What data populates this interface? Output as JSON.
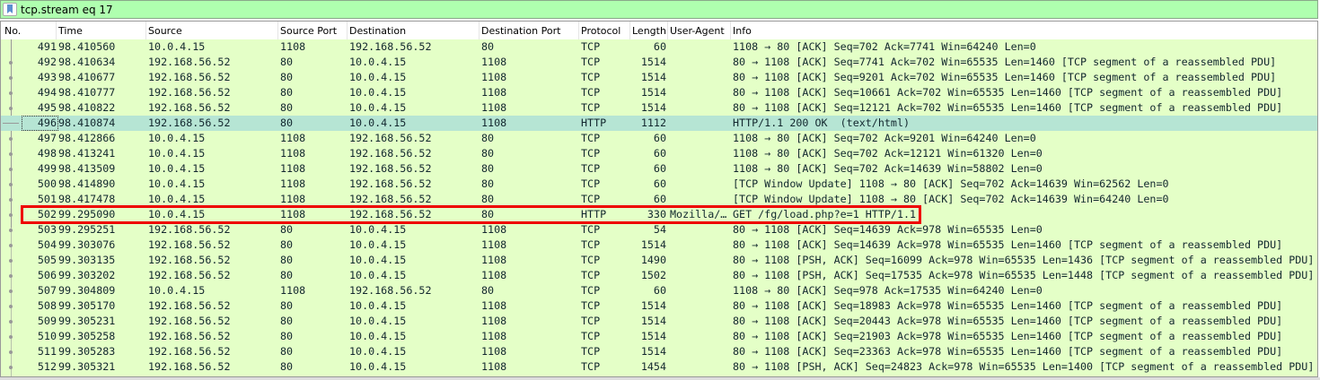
{
  "filter": {
    "value": "tcp.stream eq 17"
  },
  "columns": [
    "No.",
    "Time",
    "Source",
    "Source Port",
    "Destination",
    "Destination Port",
    "Protocol",
    "Length",
    "User-Agent",
    "Info"
  ],
  "selected_no": "496",
  "highlighted_no": "502",
  "rows": [
    [
      "491",
      "98.410560",
      "10.0.4.15",
      "1108",
      "192.168.56.52",
      "80",
      "TCP",
      "60",
      "",
      "1108 → 80 [ACK] Seq=702 Ack=7741 Win=64240 Len=0"
    ],
    [
      "492",
      "98.410634",
      "192.168.56.52",
      "80",
      "10.0.4.15",
      "1108",
      "TCP",
      "1514",
      "",
      "80 → 1108 [ACK] Seq=7741 Ack=702 Win=65535 Len=1460 [TCP segment of a reassembled PDU]"
    ],
    [
      "493",
      "98.410677",
      "192.168.56.52",
      "80",
      "10.0.4.15",
      "1108",
      "TCP",
      "1514",
      "",
      "80 → 1108 [ACK] Seq=9201 Ack=702 Win=65535 Len=1460 [TCP segment of a reassembled PDU]"
    ],
    [
      "494",
      "98.410777",
      "192.168.56.52",
      "80",
      "10.0.4.15",
      "1108",
      "TCP",
      "1514",
      "",
      "80 → 1108 [ACK] Seq=10661 Ack=702 Win=65535 Len=1460 [TCP segment of a reassembled PDU]"
    ],
    [
      "495",
      "98.410822",
      "192.168.56.52",
      "80",
      "10.0.4.15",
      "1108",
      "TCP",
      "1514",
      "",
      "80 → 1108 [ACK] Seq=12121 Ack=702 Win=65535 Len=1460 [TCP segment of a reassembled PDU]"
    ],
    [
      "496",
      "98.410874",
      "192.168.56.52",
      "80",
      "10.0.4.15",
      "1108",
      "HTTP",
      "1112",
      "",
      "HTTP/1.1 200 OK  (text/html)"
    ],
    [
      "497",
      "98.412866",
      "10.0.4.15",
      "1108",
      "192.168.56.52",
      "80",
      "TCP",
      "60",
      "",
      "1108 → 80 [ACK] Seq=702 Ack=9201 Win=64240 Len=0"
    ],
    [
      "498",
      "98.413241",
      "10.0.4.15",
      "1108",
      "192.168.56.52",
      "80",
      "TCP",
      "60",
      "",
      "1108 → 80 [ACK] Seq=702 Ack=12121 Win=61320 Len=0"
    ],
    [
      "499",
      "98.413509",
      "10.0.4.15",
      "1108",
      "192.168.56.52",
      "80",
      "TCP",
      "60",
      "",
      "1108 → 80 [ACK] Seq=702 Ack=14639 Win=58802 Len=0"
    ],
    [
      "500",
      "98.414890",
      "10.0.4.15",
      "1108",
      "192.168.56.52",
      "80",
      "TCP",
      "60",
      "",
      "[TCP Window Update] 1108 → 80 [ACK] Seq=702 Ack=14639 Win=62562 Len=0"
    ],
    [
      "501",
      "98.417478",
      "10.0.4.15",
      "1108",
      "192.168.56.52",
      "80",
      "TCP",
      "60",
      "",
      "[TCP Window Update] 1108 → 80 [ACK] Seq=702 Ack=14639 Win=64240 Len=0"
    ],
    [
      "502",
      "99.295090",
      "10.0.4.15",
      "1108",
      "192.168.56.52",
      "80",
      "HTTP",
      "330",
      "Mozilla/…",
      "GET /fg/load.php?e=1 HTTP/1.1"
    ],
    [
      "503",
      "99.295251",
      "192.168.56.52",
      "80",
      "10.0.4.15",
      "1108",
      "TCP",
      "54",
      "",
      "80 → 1108 [ACK] Seq=14639 Ack=978 Win=65535 Len=0"
    ],
    [
      "504",
      "99.303076",
      "192.168.56.52",
      "80",
      "10.0.4.15",
      "1108",
      "TCP",
      "1514",
      "",
      "80 → 1108 [ACK] Seq=14639 Ack=978 Win=65535 Len=1460 [TCP segment of a reassembled PDU]"
    ],
    [
      "505",
      "99.303135",
      "192.168.56.52",
      "80",
      "10.0.4.15",
      "1108",
      "TCP",
      "1490",
      "",
      "80 → 1108 [PSH, ACK] Seq=16099 Ack=978 Win=65535 Len=1436 [TCP segment of a reassembled PDU]"
    ],
    [
      "506",
      "99.303202",
      "192.168.56.52",
      "80",
      "10.0.4.15",
      "1108",
      "TCP",
      "1502",
      "",
      "80 → 1108 [PSH, ACK] Seq=17535 Ack=978 Win=65535 Len=1448 [TCP segment of a reassembled PDU]"
    ],
    [
      "507",
      "99.304809",
      "10.0.4.15",
      "1108",
      "192.168.56.52",
      "80",
      "TCP",
      "60",
      "",
      "1108 → 80 [ACK] Seq=978 Ack=17535 Win=64240 Len=0"
    ],
    [
      "508",
      "99.305170",
      "192.168.56.52",
      "80",
      "10.0.4.15",
      "1108",
      "TCP",
      "1514",
      "",
      "80 → 1108 [ACK] Seq=18983 Ack=978 Win=65535 Len=1460 [TCP segment of a reassembled PDU]"
    ],
    [
      "509",
      "99.305231",
      "192.168.56.52",
      "80",
      "10.0.4.15",
      "1108",
      "TCP",
      "1514",
      "",
      "80 → 1108 [ACK] Seq=20443 Ack=978 Win=65535 Len=1460 [TCP segment of a reassembled PDU]"
    ],
    [
      "510",
      "99.305258",
      "192.168.56.52",
      "80",
      "10.0.4.15",
      "1108",
      "TCP",
      "1514",
      "",
      "80 → 1108 [ACK] Seq=21903 Ack=978 Win=65535 Len=1460 [TCP segment of a reassembled PDU]"
    ],
    [
      "511",
      "99.305283",
      "192.168.56.52",
      "80",
      "10.0.4.15",
      "1108",
      "TCP",
      "1514",
      "",
      "80 → 1108 [ACK] Seq=23363 Ack=978 Win=65535 Len=1460 [TCP segment of a reassembled PDU]"
    ],
    [
      "512",
      "99.305321",
      "192.168.56.52",
      "80",
      "10.0.4.15",
      "1108",
      "TCP",
      "1454",
      "",
      "80 → 1108 [PSH, ACK] Seq=24823 Ack=978 Win=65535 Len=1400 [TCP segment of a reassembled PDU]"
    ]
  ],
  "colors": {
    "row_bg": "#e4ffc7",
    "selected_bg": "#b6e5d4",
    "filter_bg": "#afffaf",
    "highlight_box": "#ee0000"
  }
}
